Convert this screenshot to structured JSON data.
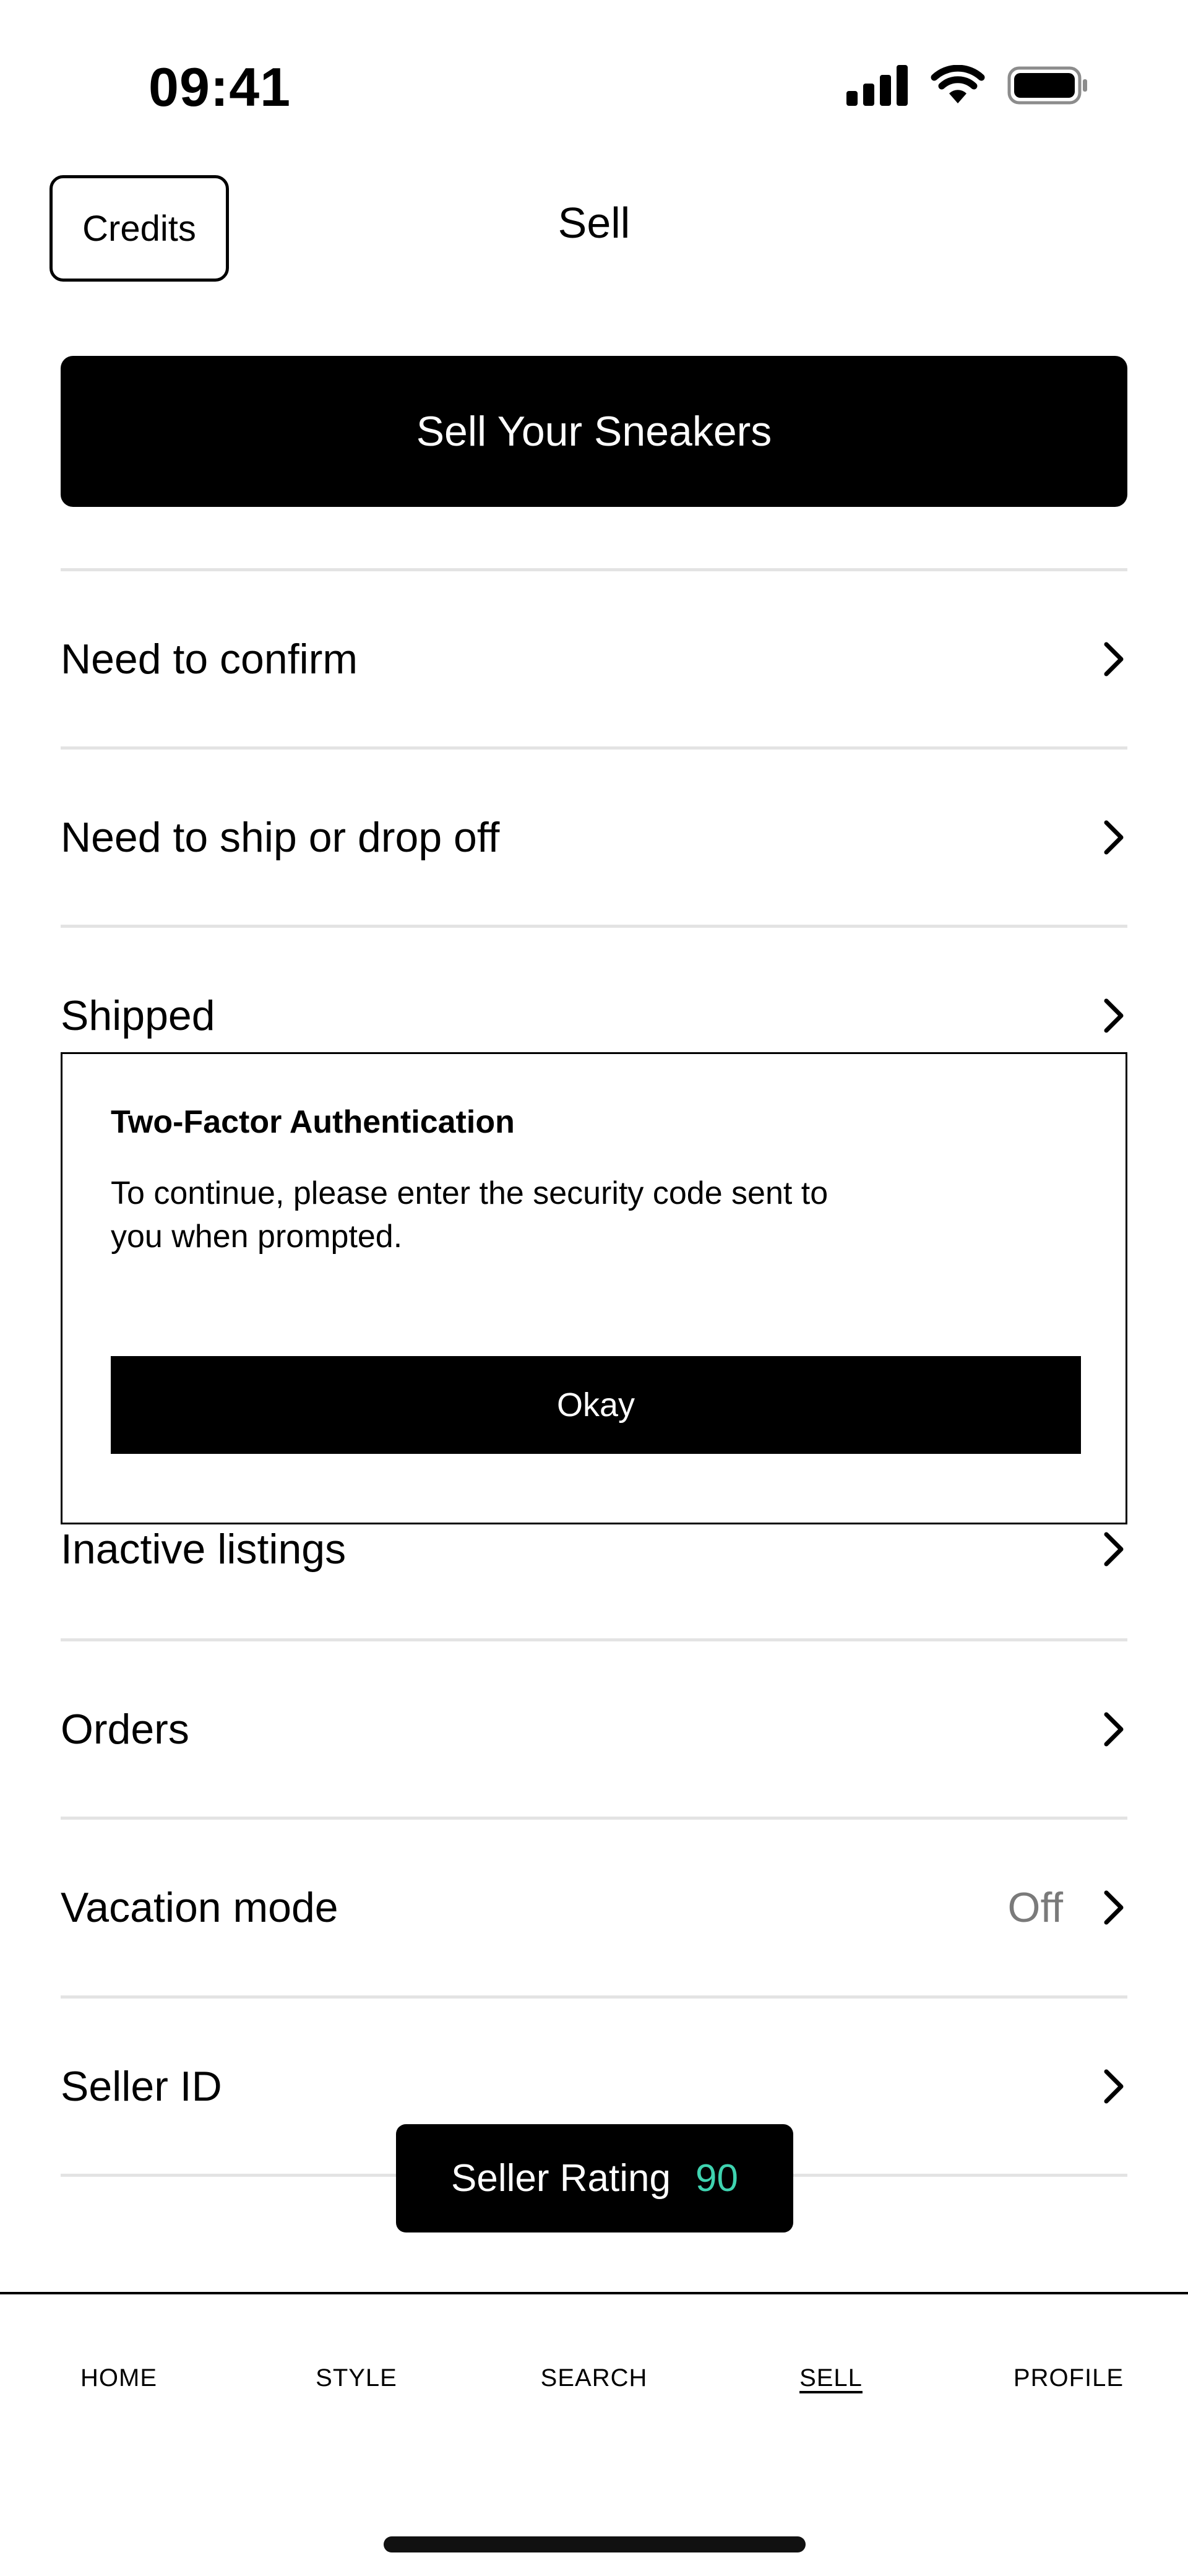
{
  "status_bar": {
    "time": "09:41"
  },
  "header": {
    "credits_label": "Credits",
    "title": "Sell"
  },
  "primary_action": {
    "label": "Sell Your Sneakers"
  },
  "menu": {
    "need_to_confirm": "Need to confirm",
    "need_to_ship": "Need to ship or drop off",
    "shipped": "Shipped",
    "inactive_listings": "Inactive listings",
    "orders": "Orders",
    "vacation_mode": "Vacation mode",
    "vacation_mode_value": "Off",
    "seller_id": "Seller ID"
  },
  "modal": {
    "title": "Two-Factor Authentication",
    "line1": "To continue, please enter the security code sent to",
    "line2": "you when prompted.",
    "button": "Okay"
  },
  "seller_rating": {
    "label": "Seller Rating",
    "value": "90",
    "value_color": "#3fd3b0"
  },
  "nav": {
    "home": "HOME",
    "style": "STYLE",
    "search": "SEARCH",
    "sell": "SELL",
    "profile": "PROFILE",
    "active": "SELL"
  }
}
